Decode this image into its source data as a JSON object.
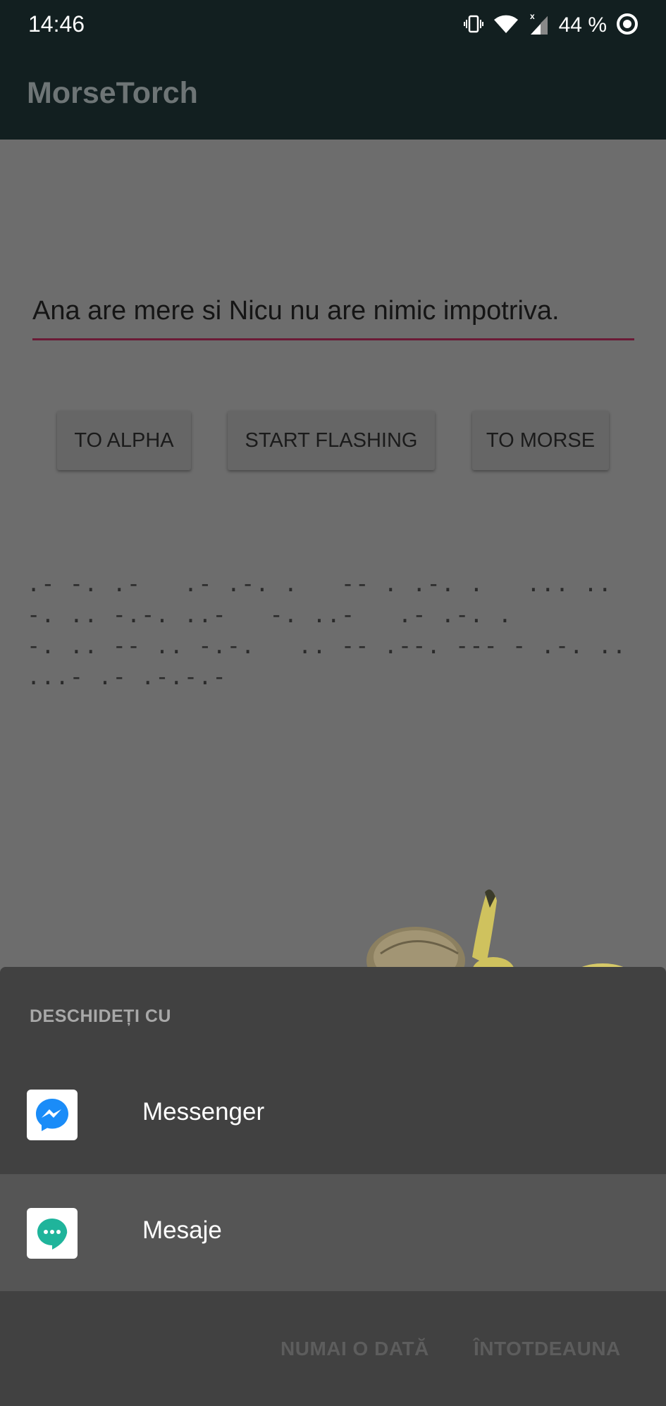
{
  "status_bar": {
    "time": "14:46",
    "battery_text": "44 %"
  },
  "app_bar": {
    "title": "MorseTorch"
  },
  "main": {
    "input_value": "Ana are mere si Nicu nu are nimic impotriva.",
    "buttons": {
      "to_alpha": "TO ALPHA",
      "start_flashing": "START FLASHING",
      "to_morse": "TO MORSE"
    },
    "morse_output": ".- -. .-   .- .-. .   -- . .-. .   ... ..   -. .. -.-. ..-   -. ..-   .- .-. .\n-. .. -- .. -.-.   .. -- .--. --- - .-. .. ...- .- .-.-.-"
  },
  "open_with_sheet": {
    "title": "DESCHIDEȚI CU",
    "apps": [
      {
        "label": "Messenger",
        "icon": "messenger-icon"
      },
      {
        "label": "Mesaje",
        "icon": "messages-icon"
      }
    ],
    "actions": {
      "just_once": "NUMAI O DATĂ",
      "always": "ÎNTOTDEAUNA"
    }
  },
  "colors": {
    "app_bar": "#121f20",
    "dimmed_background": "#6d6d6d",
    "input_underline": "#6a1a36",
    "sheet_background": "#414141",
    "selected_item": "#555555",
    "messenger_blue": "#1a8cf8",
    "messages_teal": "#1fb49b"
  }
}
